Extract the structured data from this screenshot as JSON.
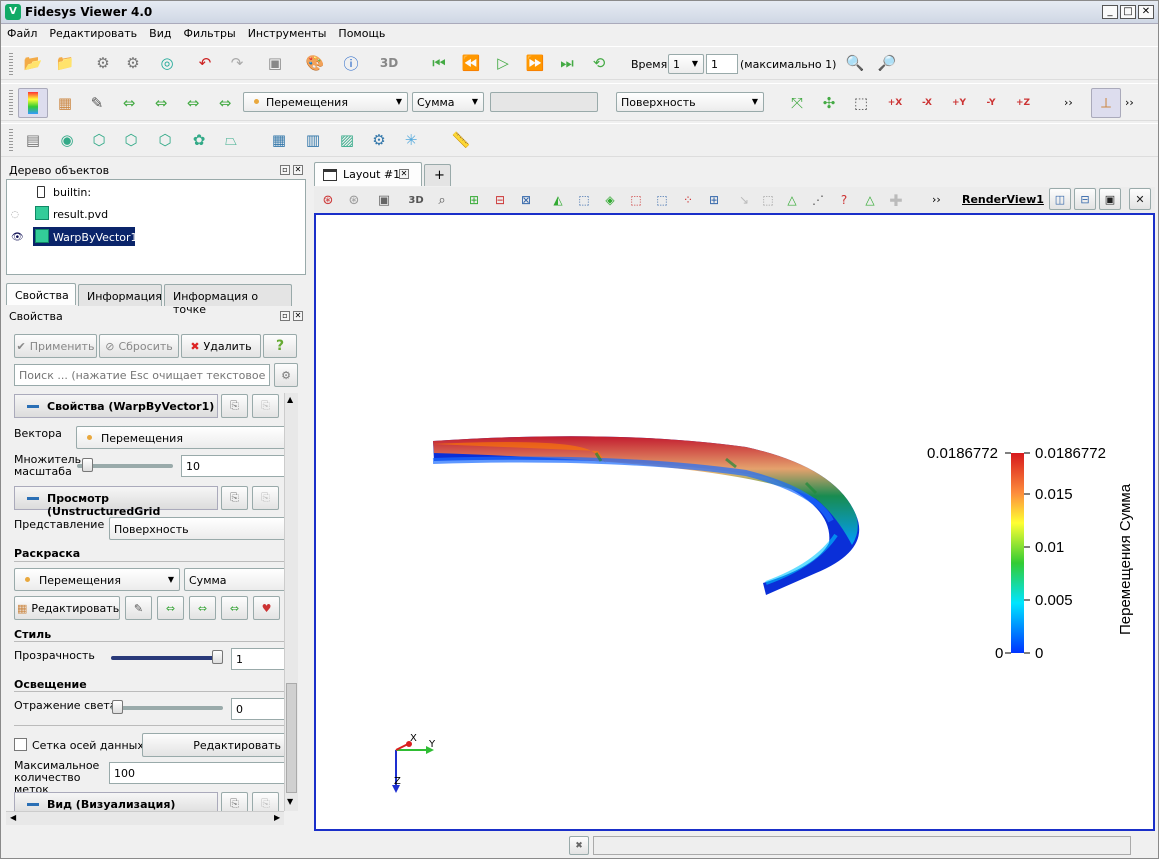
{
  "window": {
    "title": "Fidesys Viewer 4.0",
    "min": "_",
    "max": "□",
    "close": "✕"
  },
  "menu": [
    "Файл",
    "Редактировать",
    "Вид",
    "Фильтры",
    "Инструменты",
    "Помощь"
  ],
  "toolbar1": {
    "time_label": "Время:",
    "time_value": "1",
    "step_value": "1",
    "time_max": "(максимально 1)",
    "btn_3d": "3D"
  },
  "toolbar2": {
    "array_combo": "Перемещения",
    "component_combo": "Сумма",
    "repr_combo": "Поверхность",
    "axis_buttons": [
      "+X",
      "-X",
      "+Y",
      "-Y",
      "+Z",
      "-Z"
    ],
    "overflow": "››"
  },
  "pipeline": {
    "title": "Дерево объектов",
    "items": [
      {
        "label": "builtin:"
      },
      {
        "label": "result.pvd"
      },
      {
        "label": "WarpByVector1"
      }
    ]
  },
  "tabs_left": [
    "Свойства",
    "Информация",
    "Информация о точке"
  ],
  "props": {
    "title": "Свойства",
    "apply": "Применить",
    "reset": "Сбросить",
    "delete": "Удалить",
    "help": "?",
    "search_placeholder": "Поиск ... (нажатие Esc очищает текстовое поле)",
    "section_props": "Свойства (WarpByVector1)",
    "vectors_label": "Вектора",
    "vectors_value": "Перемещения",
    "scale_label": "Множитель масштаба",
    "scale_value": "10",
    "scale_fraction": 0.05,
    "section_view": "Просмотр (UnstructuredGrid",
    "repr_label": "Представление",
    "repr_value": "Поверхность",
    "coloring_header": "Раскраска",
    "coloring_array": "Перемещения",
    "coloring_comp": "Сумма",
    "edit_btn": "Редактировать",
    "style_header": "Стиль",
    "opacity_label": "Прозрачность",
    "opacity_value": "1",
    "opacity_fraction": 1,
    "lighting_header": "Освещение",
    "specular_label": "Отражение света",
    "specular_value": "0",
    "specular_fraction": 0,
    "axes_grid_label": "Сетка осей данных",
    "axes_grid_edit": "Редактировать",
    "max_ticks_label": "Максимальное количество меток",
    "max_ticks_value": "100",
    "section_vis": "Вид (Визуализация)"
  },
  "layout": {
    "tab_label": "Layout #1",
    "add_tab": "+",
    "view_3d": "3D",
    "view_name": "RenderView1",
    "overflow": "››"
  },
  "colorbar": {
    "title": "Перемещения Сумма",
    "max_left": "0.0186772",
    "min_left": "0",
    "ticks": [
      "0.0186772",
      "0.015",
      "0.01",
      "0.005",
      "0"
    ],
    "colors": [
      "#d7191c",
      "#fdae61",
      "#ffff33",
      "#1a9641",
      "#00e5ff",
      "#0033ff"
    ]
  },
  "axes": {
    "x": "X",
    "y": "Y",
    "z": "Z"
  },
  "status": {
    "close": "✖"
  }
}
